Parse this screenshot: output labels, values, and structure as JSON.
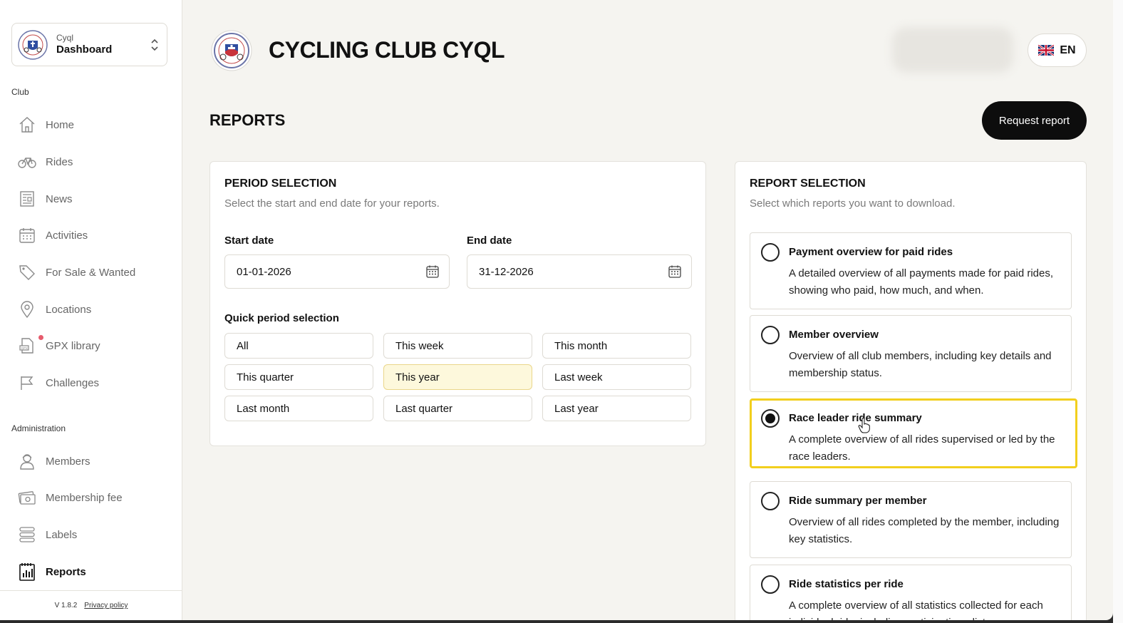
{
  "switcher": {
    "org": "Cyql",
    "context": "Dashboard"
  },
  "sidebar": {
    "club_section": "Club",
    "admin_section": "Administration",
    "club_items": [
      {
        "label": "Home",
        "icon": "home-icon"
      },
      {
        "label": "Rides",
        "icon": "bike-icon"
      },
      {
        "label": "News",
        "icon": "news-icon"
      },
      {
        "label": "Activities",
        "icon": "calendar-icon"
      },
      {
        "label": "For Sale & Wanted",
        "icon": "tag-icon"
      },
      {
        "label": "Locations",
        "icon": "location-pin-icon"
      },
      {
        "label": "GPX library",
        "icon": "gpx-file-icon"
      },
      {
        "label": "Challenges",
        "icon": "flag-icon"
      }
    ],
    "admin_items": [
      {
        "label": "Members",
        "icon": "member-icon"
      },
      {
        "label": "Membership fee",
        "icon": "money-icon"
      },
      {
        "label": "Labels",
        "icon": "labels-icon"
      },
      {
        "label": "Reports",
        "icon": "reports-icon"
      }
    ],
    "version": "V 1.8.2",
    "privacy": "Privacy policy"
  },
  "header": {
    "club_name": "CYCLING CLUB CYQL",
    "language": "EN"
  },
  "page": {
    "title": "REPORTS",
    "request_button": "Request report"
  },
  "period": {
    "title": "PERIOD SELECTION",
    "subtitle": "Select the start and end date for your reports.",
    "start_label": "Start date",
    "start_value": "01-01-2026",
    "end_label": "End date",
    "end_value": "31-12-2026",
    "quick_label": "Quick period selection",
    "quick_options": [
      "All",
      "This week",
      "This month",
      "This quarter",
      "This year",
      "Last week",
      "Last month",
      "Last quarter",
      "Last year"
    ],
    "selected_quick": "This year"
  },
  "reports": {
    "title": "REPORT SELECTION",
    "subtitle": "Select which reports you want to download.",
    "options": [
      {
        "title": "Payment overview for paid rides",
        "desc": "A detailed overview of all payments made for paid rides, showing who paid, how much, and when."
      },
      {
        "title": "Member overview",
        "desc": "Overview of all club members, including key details and membership status."
      },
      {
        "title": "Race leader ride summary",
        "desc": "A complete overview of all rides supervised or led by the race leaders."
      },
      {
        "title": "Ride summary per member",
        "desc": "Overview of all rides completed by the member, including key statistics."
      },
      {
        "title": "Ride statistics per ride",
        "desc": "A complete overview of all statistics collected for each individual ride, including participation, distance,"
      }
    ],
    "selected": "Race leader ride summary"
  },
  "colors": {
    "accent": "#f2cf1d",
    "selected_quick_bg": "#fdf8dc",
    "primary_button": "#0d0d0d",
    "notification_dot": "#e65b6d"
  }
}
